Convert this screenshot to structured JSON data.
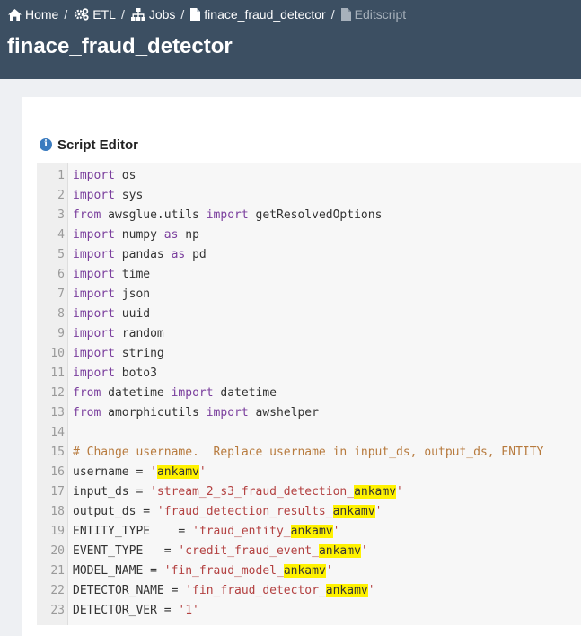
{
  "breadcrumb": {
    "items": [
      {
        "label": "Home",
        "icon": "home-icon"
      },
      {
        "label": "ETL",
        "icon": "cogs-icon"
      },
      {
        "label": "Jobs",
        "icon": "sitemap-icon"
      },
      {
        "label": "finace_fraud_detector",
        "icon": "file-icon"
      },
      {
        "label": "Editscript",
        "icon": "file-icon"
      }
    ],
    "separator": "/"
  },
  "page_title": "finace_fraud_detector",
  "script_editor": {
    "title": "Script Editor",
    "info_icon": "i",
    "lines": [
      {
        "n": "1",
        "parts": [
          [
            "kw",
            "import"
          ],
          [
            "",
            "os"
          ]
        ]
      },
      {
        "n": "2",
        "parts": [
          [
            "kw",
            "import"
          ],
          [
            "",
            "sys"
          ]
        ]
      },
      {
        "n": "3",
        "parts": [
          [
            "kw",
            "from"
          ],
          [
            "",
            "awsglue.utils"
          ],
          [
            "kw",
            "import"
          ],
          [
            "",
            "getResolvedOptions"
          ]
        ]
      },
      {
        "n": "4",
        "parts": [
          [
            "kw",
            "import"
          ],
          [
            "",
            "numpy"
          ],
          [
            "kw",
            "as"
          ],
          [
            "",
            "np"
          ]
        ]
      },
      {
        "n": "5",
        "parts": [
          [
            "kw",
            "import"
          ],
          [
            "",
            "pandas"
          ],
          [
            "kw",
            "as"
          ],
          [
            "",
            "pd"
          ]
        ]
      },
      {
        "n": "6",
        "parts": [
          [
            "kw",
            "import"
          ],
          [
            "",
            "time"
          ]
        ]
      },
      {
        "n": "7",
        "parts": [
          [
            "kw",
            "import"
          ],
          [
            "",
            "json"
          ]
        ]
      },
      {
        "n": "8",
        "parts": [
          [
            "kw",
            "import"
          ],
          [
            "",
            "uuid"
          ]
        ]
      },
      {
        "n": "9",
        "parts": [
          [
            "kw",
            "import"
          ],
          [
            "",
            "random"
          ]
        ]
      },
      {
        "n": "10",
        "parts": [
          [
            "kw",
            "import"
          ],
          [
            "",
            "string"
          ]
        ]
      },
      {
        "n": "11",
        "parts": [
          [
            "kw",
            "import"
          ],
          [
            "",
            "boto3"
          ]
        ]
      },
      {
        "n": "12",
        "parts": [
          [
            "kw",
            "from"
          ],
          [
            "",
            "datetime"
          ],
          [
            "kw",
            "import"
          ],
          [
            "",
            "datetime"
          ]
        ]
      },
      {
        "n": "13",
        "parts": [
          [
            "kw",
            "from"
          ],
          [
            "",
            "amorphicutils"
          ],
          [
            "kw",
            "import"
          ],
          [
            "",
            "awshelper"
          ]
        ]
      },
      {
        "n": "14",
        "parts": []
      },
      {
        "n": "15",
        "parts": [
          [
            "cm",
            "# Change username.  Replace username in input_ds, output_ds, ENTITY"
          ]
        ]
      },
      {
        "n": "16",
        "parts": [
          [
            "",
            "username = "
          ],
          [
            "st",
            "'"
          ],
          [
            "hl",
            "ankamv"
          ],
          [
            "st",
            "'"
          ]
        ]
      },
      {
        "n": "17",
        "parts": [
          [
            "",
            "input_ds = "
          ],
          [
            "st",
            "'stream_2_s3_fraud_detection_"
          ],
          [
            "hl",
            "ankamv"
          ],
          [
            "st",
            "'"
          ]
        ]
      },
      {
        "n": "18",
        "parts": [
          [
            "",
            "output_ds = "
          ],
          [
            "st",
            "'fraud_detection_results_"
          ],
          [
            "hl",
            "ankamv"
          ],
          [
            "st",
            "'"
          ]
        ]
      },
      {
        "n": "19",
        "parts": [
          [
            "",
            "ENTITY_TYPE    = "
          ],
          [
            "st",
            "'fraud_entity_"
          ],
          [
            "hl",
            "ankamv"
          ],
          [
            "st",
            "'"
          ]
        ]
      },
      {
        "n": "20",
        "parts": [
          [
            "",
            "EVENT_TYPE   = "
          ],
          [
            "st",
            "'credit_fraud_event_"
          ],
          [
            "hl",
            "ankamv"
          ],
          [
            "st",
            "'"
          ]
        ]
      },
      {
        "n": "21",
        "parts": [
          [
            "",
            "MODEL_NAME = "
          ],
          [
            "st",
            "'fin_fraud_model_"
          ],
          [
            "hl",
            "ankamv"
          ],
          [
            "st",
            "'"
          ]
        ]
      },
      {
        "n": "22",
        "parts": [
          [
            "",
            "DETECTOR_NAME = "
          ],
          [
            "st",
            "'fin_fraud_detector_"
          ],
          [
            "hl",
            "ankamv"
          ],
          [
            "st",
            "'"
          ]
        ]
      },
      {
        "n": "23",
        "parts": [
          [
            "",
            "DETECTOR_VER = "
          ],
          [
            "st",
            "'1'"
          ]
        ]
      }
    ]
  },
  "colors": {
    "header_bg": "#3c4f62",
    "keyword": "#7a3e9d",
    "comment": "#b77a3d",
    "string": "#b34141",
    "highlight": "#fff200"
  }
}
